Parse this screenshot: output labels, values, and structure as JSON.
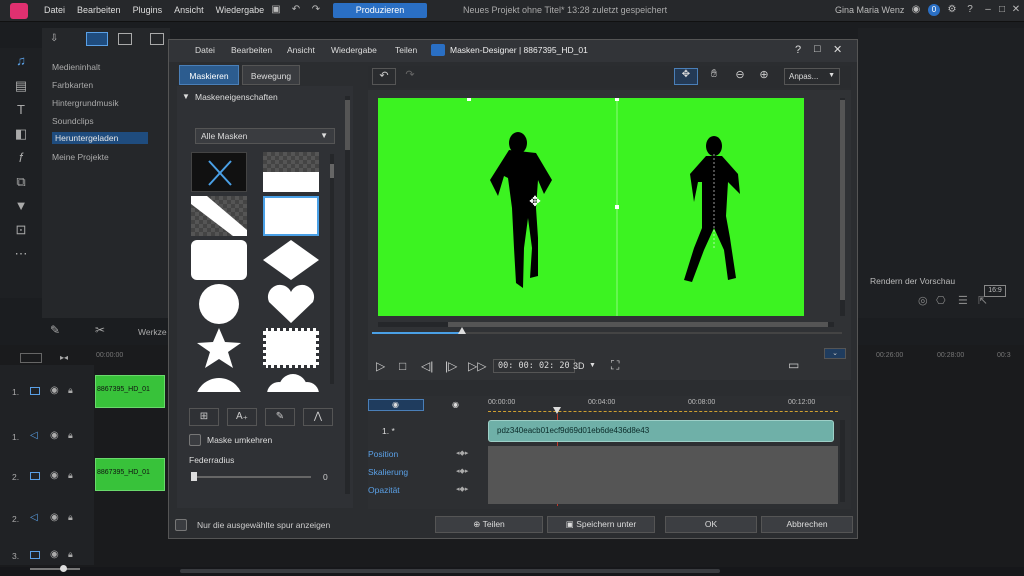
{
  "app": {
    "menu": [
      "Datei",
      "Bearbeiten",
      "Plugins",
      "Ansicht",
      "Wiedergabe"
    ],
    "produce_label": "Produzieren",
    "project_title": "Neues Projekt ohne Titel* 13:28 zuletzt gespeichert",
    "user_name": "Gina Maria Wenz",
    "user_badge": "0"
  },
  "media_panel": {
    "items": [
      "Medieninhalt",
      "Farbkarten",
      "Hintergrundmusik",
      "Soundclips",
      "Heruntergeladen",
      "Meine Projekte"
    ],
    "selected_index": 4
  },
  "right_panel": {
    "render_preview_label": "Rendern der Vorschau",
    "aspect_label": "16:9"
  },
  "timeline": {
    "toolbar_label": "Werkze",
    "ruler_times": [
      "00:00:00",
      "00:26:00",
      "00:28:00",
      "00:3"
    ],
    "tracks": [
      {
        "label": "1.",
        "clip": "8867395_HD_01"
      },
      {
        "label": "1.",
        "clip": ""
      },
      {
        "label": "2.",
        "clip": "8867395_HD_01"
      },
      {
        "label": "2.",
        "clip": ""
      },
      {
        "label": "3.",
        "clip": ""
      }
    ]
  },
  "dialog": {
    "menu": [
      "Datei",
      "Bearbeiten",
      "Ansicht",
      "Wiedergabe",
      "Teilen"
    ],
    "title": "Masken-Designer | 8867395_HD_01",
    "tabs": [
      "Maskieren",
      "Bewegung"
    ],
    "section_title": "Maskeneigenschaften",
    "mask_dropdown": "Alle Masken",
    "invert_label": "Maske umkehren",
    "feather_label": "Federradius",
    "feather_value": "0",
    "fit_dropdown": "Anpas...",
    "timecode": "00: 00: 02: 20",
    "mode_3d": "3D",
    "kf_ruler": [
      "00:00:00",
      "00:04:00",
      "00:08:00",
      "00:12:00"
    ],
    "kf_track_label": "1. *",
    "kf_track_name": "*",
    "kf_clip_id": "pdz340eacb01ecf9d69d01eb6de436d8e43",
    "kf_rows": [
      "Position",
      "Skalierung",
      "Opazität"
    ],
    "only_selected_label": "Nur die ausgewählte spur anzeigen",
    "buttons": {
      "share": "Teilen",
      "save_as": "Speichern unter",
      "ok": "OK",
      "cancel": "Abbrechen"
    }
  },
  "colors": {
    "accent": "#2a6fc4",
    "chroma_green": "#3cf321",
    "clip_green": "#38c23a"
  }
}
